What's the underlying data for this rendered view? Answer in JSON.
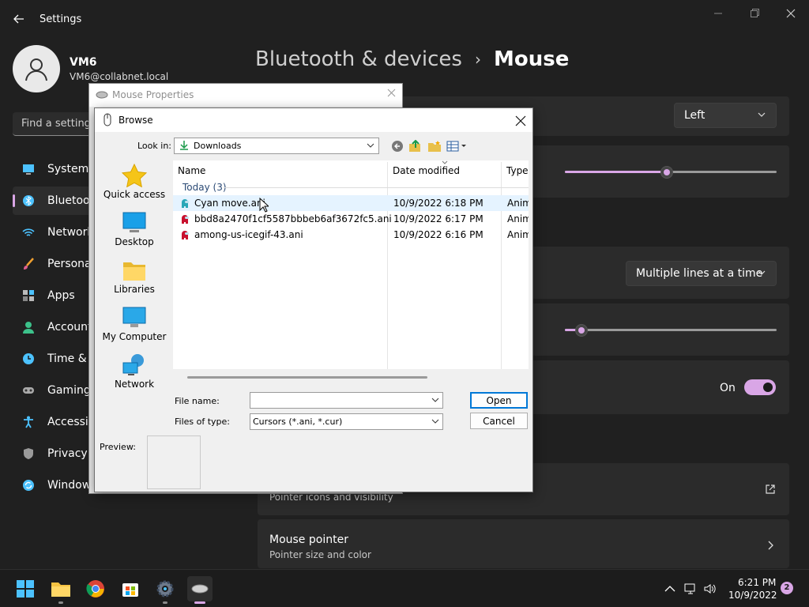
{
  "settings": {
    "app_title": "Settings",
    "user": {
      "name": "VM6",
      "email": "VM6@collabnet.local"
    },
    "search_placeholder": "Find a setting",
    "nav": [
      {
        "label": "System",
        "icon": "monitor-icon",
        "active": false
      },
      {
        "label": "Bluetooth & devices",
        "icon": "bluetooth-icon",
        "active": true
      },
      {
        "label": "Network & internet",
        "icon": "wifi-icon",
        "active": false
      },
      {
        "label": "Personalization",
        "icon": "brush-icon",
        "active": false
      },
      {
        "label": "Apps",
        "icon": "apps-icon",
        "active": false
      },
      {
        "label": "Accounts",
        "icon": "person-icon",
        "active": false
      },
      {
        "label": "Time & language",
        "icon": "clock-globe-icon",
        "active": false
      },
      {
        "label": "Gaming",
        "icon": "gamepad-icon",
        "active": false
      },
      {
        "label": "Accessibility",
        "icon": "accessibility-icon",
        "active": false
      },
      {
        "label": "Privacy & security",
        "icon": "shield-icon",
        "active": false
      },
      {
        "label": "Windows Update",
        "icon": "update-icon",
        "active": false
      }
    ],
    "breadcrumb": {
      "parent": "Bluetooth & devices",
      "separator": "›",
      "current": "Mouse"
    },
    "primary_button_value": "Left",
    "cursor_speed_fraction": 0.48,
    "scroll_mode_value": "Multiple lines at a time",
    "scroll_lines_fraction": 0.05,
    "toggle_label": "On",
    "toggle_on": true,
    "cards": [
      {
        "title": "",
        "subtitle": "Pointer icons and visibility"
      },
      {
        "title": "Mouse pointer",
        "subtitle": "Pointer size and color"
      }
    ],
    "accent_color": "#d9a6e6"
  },
  "mouse_properties": {
    "title": "Mouse Properties"
  },
  "browse": {
    "title": "Browse",
    "look_in_label": "Look in:",
    "look_in_value": "Downloads",
    "places": [
      {
        "label": "Quick access",
        "icon": "star-icon"
      },
      {
        "label": "Desktop",
        "icon": "desktop-icon"
      },
      {
        "label": "Libraries",
        "icon": "folder-icon"
      },
      {
        "label": "My Computer",
        "icon": "computer-icon"
      },
      {
        "label": "Network",
        "icon": "network-icon"
      }
    ],
    "columns": {
      "name": "Name",
      "date": "Date modified",
      "type": "Type"
    },
    "group": "Today (3)",
    "files": [
      {
        "name": "Cyan move.ani",
        "date": "10/9/2022 6:18 PM",
        "type": "Anim",
        "icon_color": "#2aa8b8"
      },
      {
        "name": "bbd8a2470f1cf5587bbbeb6af3672fc5.ani",
        "date": "10/9/2022 6:17 PM",
        "type": "Anim",
        "icon_color": "#c8102e"
      },
      {
        "name": "among-us-icegif-43.ani",
        "date": "10/9/2022 6:16 PM",
        "type": "Anim",
        "icon_color": "#c8102e"
      }
    ],
    "file_name_label": "File name:",
    "file_name_value": "",
    "file_type_label": "Files of type:",
    "file_type_value": "Cursors (*.ani, *.cur)",
    "open_label": "Open",
    "cancel_label": "Cancel",
    "preview_label": "Preview:"
  },
  "taskbar": {
    "apps": [
      "start-icon",
      "file-explorer-icon",
      "chrome-icon",
      "store-icon",
      "settings-gear-icon",
      "mouse-icon"
    ],
    "time": "6:21 PM",
    "date": "10/9/2022",
    "notification_count": "2"
  }
}
